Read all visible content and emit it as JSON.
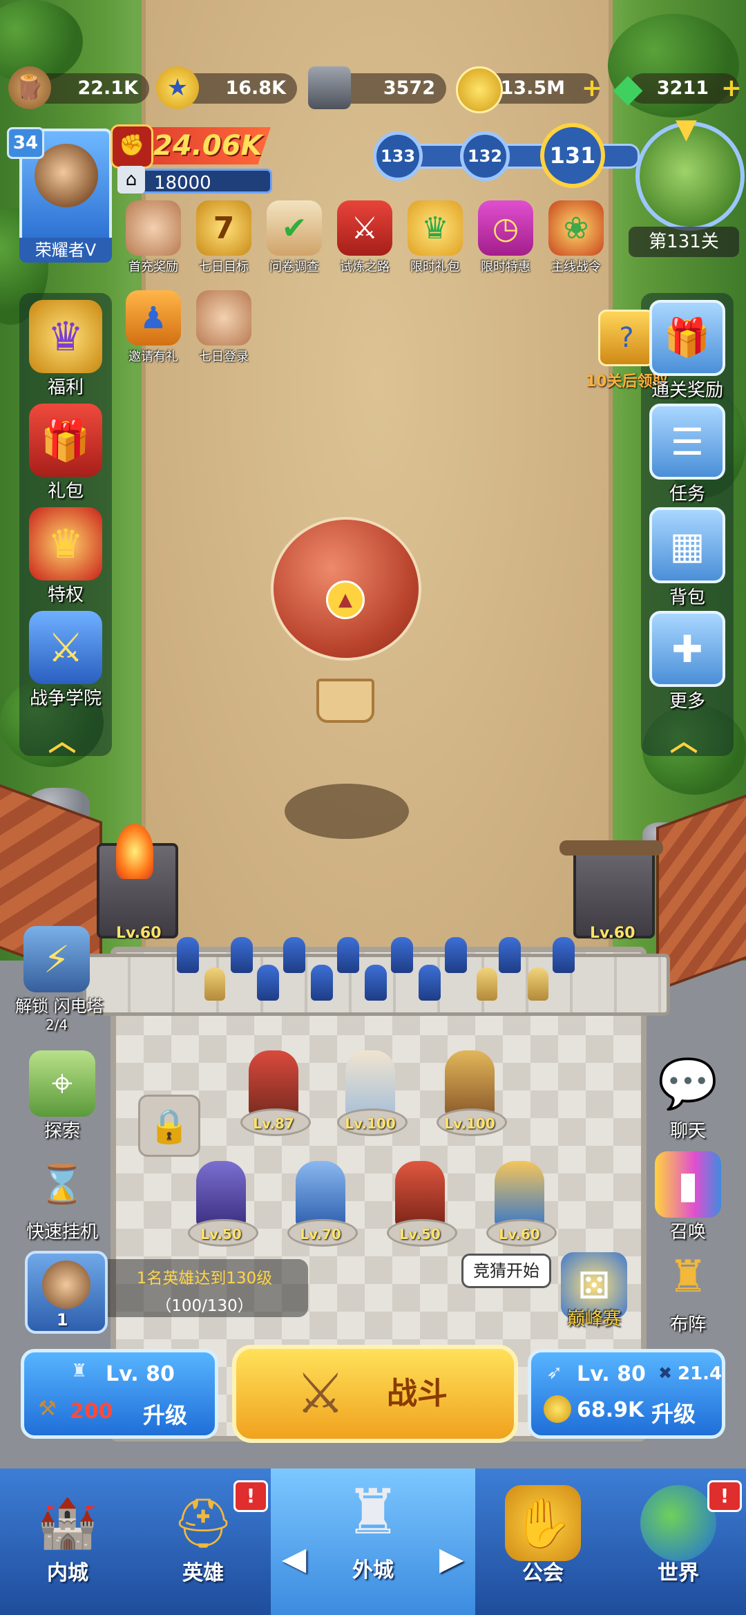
{
  "resources": [
    {
      "name": "wood",
      "value": "22.1K",
      "icon": "wood-log-icon"
    },
    {
      "name": "star",
      "value": "16.8K",
      "icon": "star-coin-icon"
    },
    {
      "name": "iron",
      "value": "3572",
      "icon": "iron-ingot-icon"
    },
    {
      "name": "gold",
      "value": "13.5M",
      "icon": "gold-coin-icon",
      "plus": "+"
    },
    {
      "name": "gem",
      "value": "3211",
      "icon": "green-gem-icon",
      "plus": "+"
    }
  ],
  "player": {
    "level": "34",
    "vip": "荣耀者V",
    "power": "24.06K",
    "troops": "18000"
  },
  "stages": {
    "prev2": "133",
    "prev1": "132",
    "current": "131",
    "label": "第131关"
  },
  "events_row1": [
    {
      "label": "首充奖励",
      "icon": "girl-avatar-icon"
    },
    {
      "label": "七日目标",
      "icon": "seven-badge-icon"
    },
    {
      "label": "问卷调查",
      "icon": "survey-icon"
    },
    {
      "label": "试炼之路",
      "icon": "crossed-swords-icon"
    },
    {
      "label": "限时礼包",
      "icon": "crown-gift-icon"
    },
    {
      "label": "限时特惠",
      "icon": "clock-gift-icon"
    },
    {
      "label": "主线战令",
      "icon": "battle-pass-icon"
    }
  ],
  "events_row2": [
    {
      "label": "邀请有礼",
      "icon": "invite-gift-icon"
    },
    {
      "label": "七日登录",
      "icon": "girl-avatar-icon"
    }
  ],
  "left_menu": [
    {
      "label": "福利",
      "icon": "crown-shield-icon"
    },
    {
      "label": "礼包",
      "icon": "gift-box-icon"
    },
    {
      "label": "特权",
      "icon": "red-crown-icon"
    },
    {
      "label": "战争学院",
      "icon": "crossed-swords-shield-icon"
    }
  ],
  "right_menu": [
    {
      "label": "通关奖励",
      "icon": "gift-ribbon-icon"
    },
    {
      "label": "任务",
      "icon": "task-scroll-icon"
    },
    {
      "label": "背包",
      "icon": "backpack-icon"
    },
    {
      "label": "更多",
      "icon": "plus-cross-icon"
    }
  ],
  "reward_hint": "10关后领取",
  "reward_hint_mark": "?",
  "towers": {
    "left_lv": "Lv.60",
    "right_lv": "Lv.60"
  },
  "lightning_tower": {
    "label": "解锁 闪电塔",
    "progress": "2/4"
  },
  "heroes_top": [
    {
      "lv": "Lv.87",
      "color": "#d94a3c"
    },
    {
      "lv": "Lv.100",
      "color": "#e6d8c0"
    },
    {
      "lv": "Lv.100",
      "color": "#c89a4a"
    }
  ],
  "heroes_bottom": [
    {
      "lv": "Lv.50",
      "color": "#5a4fb0"
    },
    {
      "lv": "Lv.70",
      "color": "#4a7fd0"
    },
    {
      "lv": "Lv.50",
      "color": "#c0392b"
    },
    {
      "lv": "Lv.60",
      "color": "#f0b640"
    }
  ],
  "left_misc": [
    {
      "label": "探索",
      "icon": "map-scroll-icon"
    },
    {
      "label": "快速挂机",
      "icon": "hourglass-icon"
    }
  ],
  "right_misc": [
    {
      "label": "聊天",
      "icon": "chat-bubble-icon"
    },
    {
      "label": "召唤",
      "icon": "summon-cards-icon"
    },
    {
      "label": "布阵",
      "icon": "chess-rook-icon"
    }
  ],
  "quest": {
    "text": "1名英雄达到130级",
    "progress": "（100/130）",
    "count": "1"
  },
  "guess_bubble": "竞猜开始",
  "peak": {
    "label": "巅峰赛"
  },
  "castle_upgrade": {
    "lv": "Lv. 80",
    "cost": "200",
    "btn": "升级"
  },
  "fight_label": "战斗",
  "archer_upgrade": {
    "lv": "Lv. 80",
    "stat": "21.4",
    "cost": "68.9K",
    "btn": "升级"
  },
  "nav": [
    {
      "label": "内城",
      "icon": "castle-icon"
    },
    {
      "label": "英雄",
      "icon": "knight-helmet-icon",
      "badge": "!"
    },
    {
      "label": "外城",
      "icon": "outer-castle-icon"
    },
    {
      "label": "公会",
      "icon": "handshake-icon"
    },
    {
      "label": "世界",
      "icon": "globe-icon",
      "badge": "!"
    }
  ],
  "nav_arrows": {
    "left": "◀",
    "right": "▶"
  }
}
